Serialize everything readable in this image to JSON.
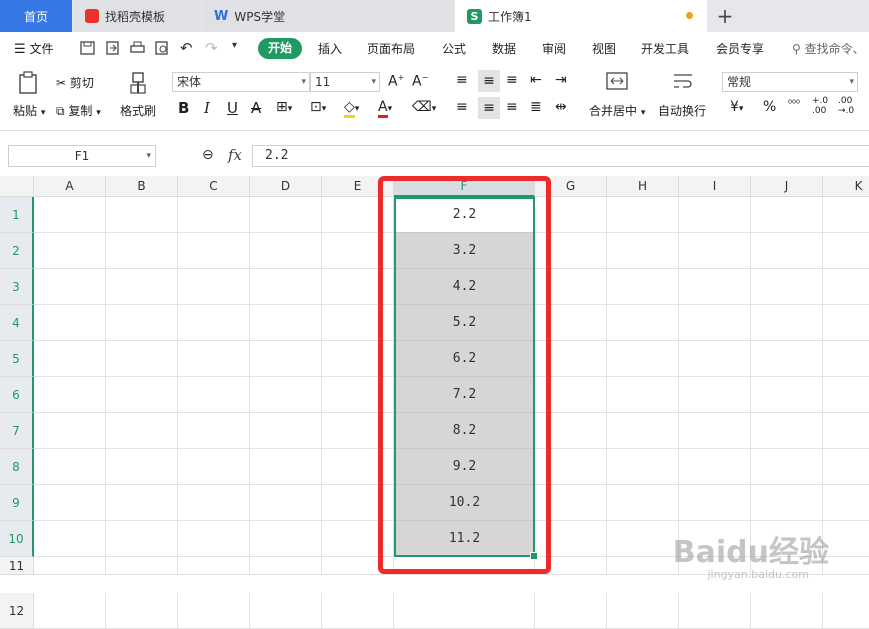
{
  "tabs": {
    "home": "首页",
    "template": "找稻壳模板",
    "wps_academy": "WPS学堂",
    "workbook": "工作簿1",
    "add": "+"
  },
  "menu": {
    "file": "文件",
    "start": "开始",
    "items": [
      "插入",
      "页面布局",
      "公式",
      "数据",
      "审阅",
      "视图",
      "开发工具",
      "会员专享"
    ],
    "search": "查找命令、"
  },
  "ribbon": {
    "paste": "粘贴",
    "cut": "剪切",
    "copy": "复制",
    "format_painter": "格式刷",
    "font_name": "宋体",
    "font_size": "11",
    "merge_center": "合并居中",
    "wrap_text": "自动换行",
    "number_format": "常规",
    "currency": "¥",
    "percent": "%"
  },
  "formula_bar": {
    "name_box": "F1",
    "fx": "fx",
    "value": "2.2"
  },
  "grid": {
    "columns": [
      "A",
      "B",
      "C",
      "D",
      "E",
      "F",
      "G",
      "H",
      "I",
      "J",
      "K"
    ],
    "selected_column": "F",
    "rows": [
      "1",
      "2",
      "3",
      "4",
      "5",
      "6",
      "7",
      "8",
      "9",
      "10",
      "11",
      "12"
    ],
    "f_values": [
      "2.2",
      "3.2",
      "4.2",
      "5.2",
      "6.2",
      "7.2",
      "8.2",
      "9.2",
      "10.2",
      "11.2"
    ]
  },
  "colors": {
    "accent": "#1f9a62",
    "home_tab": "#3677e6",
    "highlight": "#ee2a2a"
  },
  "watermark": {
    "brand": "Baidu经验",
    "url": "jingyan.baidu.com"
  }
}
